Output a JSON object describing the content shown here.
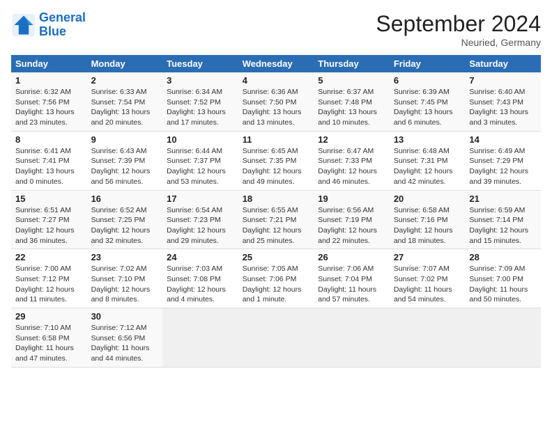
{
  "header": {
    "logo_line1": "General",
    "logo_line2": "Blue",
    "month": "September 2024",
    "location": "Neuried, Germany"
  },
  "columns": [
    "Sunday",
    "Monday",
    "Tuesday",
    "Wednesday",
    "Thursday",
    "Friday",
    "Saturday"
  ],
  "rows": [
    [
      {
        "day": "1",
        "sunrise": "Sunrise: 6:32 AM",
        "sunset": "Sunset: 7:56 PM",
        "daylight": "Daylight: 13 hours and 23 minutes."
      },
      {
        "day": "2",
        "sunrise": "Sunrise: 6:33 AM",
        "sunset": "Sunset: 7:54 PM",
        "daylight": "Daylight: 13 hours and 20 minutes."
      },
      {
        "day": "3",
        "sunrise": "Sunrise: 6:34 AM",
        "sunset": "Sunset: 7:52 PM",
        "daylight": "Daylight: 13 hours and 17 minutes."
      },
      {
        "day": "4",
        "sunrise": "Sunrise: 6:36 AM",
        "sunset": "Sunset: 7:50 PM",
        "daylight": "Daylight: 13 hours and 13 minutes."
      },
      {
        "day": "5",
        "sunrise": "Sunrise: 6:37 AM",
        "sunset": "Sunset: 7:48 PM",
        "daylight": "Daylight: 13 hours and 10 minutes."
      },
      {
        "day": "6",
        "sunrise": "Sunrise: 6:39 AM",
        "sunset": "Sunset: 7:45 PM",
        "daylight": "Daylight: 13 hours and 6 minutes."
      },
      {
        "day": "7",
        "sunrise": "Sunrise: 6:40 AM",
        "sunset": "Sunset: 7:43 PM",
        "daylight": "Daylight: 13 hours and 3 minutes."
      }
    ],
    [
      {
        "day": "8",
        "sunrise": "Sunrise: 6:41 AM",
        "sunset": "Sunset: 7:41 PM",
        "daylight": "Daylight: 13 hours and 0 minutes."
      },
      {
        "day": "9",
        "sunrise": "Sunrise: 6:43 AM",
        "sunset": "Sunset: 7:39 PM",
        "daylight": "Daylight: 12 hours and 56 minutes."
      },
      {
        "day": "10",
        "sunrise": "Sunrise: 6:44 AM",
        "sunset": "Sunset: 7:37 PM",
        "daylight": "Daylight: 12 hours and 53 minutes."
      },
      {
        "day": "11",
        "sunrise": "Sunrise: 6:45 AM",
        "sunset": "Sunset: 7:35 PM",
        "daylight": "Daylight: 12 hours and 49 minutes."
      },
      {
        "day": "12",
        "sunrise": "Sunrise: 6:47 AM",
        "sunset": "Sunset: 7:33 PM",
        "daylight": "Daylight: 12 hours and 46 minutes."
      },
      {
        "day": "13",
        "sunrise": "Sunrise: 6:48 AM",
        "sunset": "Sunset: 7:31 PM",
        "daylight": "Daylight: 12 hours and 42 minutes."
      },
      {
        "day": "14",
        "sunrise": "Sunrise: 6:49 AM",
        "sunset": "Sunset: 7:29 PM",
        "daylight": "Daylight: 12 hours and 39 minutes."
      }
    ],
    [
      {
        "day": "15",
        "sunrise": "Sunrise: 6:51 AM",
        "sunset": "Sunset: 7:27 PM",
        "daylight": "Daylight: 12 hours and 36 minutes."
      },
      {
        "day": "16",
        "sunrise": "Sunrise: 6:52 AM",
        "sunset": "Sunset: 7:25 PM",
        "daylight": "Daylight: 12 hours and 32 minutes."
      },
      {
        "day": "17",
        "sunrise": "Sunrise: 6:54 AM",
        "sunset": "Sunset: 7:23 PM",
        "daylight": "Daylight: 12 hours and 29 minutes."
      },
      {
        "day": "18",
        "sunrise": "Sunrise: 6:55 AM",
        "sunset": "Sunset: 7:21 PM",
        "daylight": "Daylight: 12 hours and 25 minutes."
      },
      {
        "day": "19",
        "sunrise": "Sunrise: 6:56 AM",
        "sunset": "Sunset: 7:19 PM",
        "daylight": "Daylight: 12 hours and 22 minutes."
      },
      {
        "day": "20",
        "sunrise": "Sunrise: 6:58 AM",
        "sunset": "Sunset: 7:16 PM",
        "daylight": "Daylight: 12 hours and 18 minutes."
      },
      {
        "day": "21",
        "sunrise": "Sunrise: 6:59 AM",
        "sunset": "Sunset: 7:14 PM",
        "daylight": "Daylight: 12 hours and 15 minutes."
      }
    ],
    [
      {
        "day": "22",
        "sunrise": "Sunrise: 7:00 AM",
        "sunset": "Sunset: 7:12 PM",
        "daylight": "Daylight: 12 hours and 11 minutes."
      },
      {
        "day": "23",
        "sunrise": "Sunrise: 7:02 AM",
        "sunset": "Sunset: 7:10 PM",
        "daylight": "Daylight: 12 hours and 8 minutes."
      },
      {
        "day": "24",
        "sunrise": "Sunrise: 7:03 AM",
        "sunset": "Sunset: 7:08 PM",
        "daylight": "Daylight: 12 hours and 4 minutes."
      },
      {
        "day": "25",
        "sunrise": "Sunrise: 7:05 AM",
        "sunset": "Sunset: 7:06 PM",
        "daylight": "Daylight: 12 hours and 1 minute."
      },
      {
        "day": "26",
        "sunrise": "Sunrise: 7:06 AM",
        "sunset": "Sunset: 7:04 PM",
        "daylight": "Daylight: 11 hours and 57 minutes."
      },
      {
        "day": "27",
        "sunrise": "Sunrise: 7:07 AM",
        "sunset": "Sunset: 7:02 PM",
        "daylight": "Daylight: 11 hours and 54 minutes."
      },
      {
        "day": "28",
        "sunrise": "Sunrise: 7:09 AM",
        "sunset": "Sunset: 7:00 PM",
        "daylight": "Daylight: 11 hours and 50 minutes."
      }
    ],
    [
      {
        "day": "29",
        "sunrise": "Sunrise: 7:10 AM",
        "sunset": "Sunset: 6:58 PM",
        "daylight": "Daylight: 11 hours and 47 minutes."
      },
      {
        "day": "30",
        "sunrise": "Sunrise: 7:12 AM",
        "sunset": "Sunset: 6:56 PM",
        "daylight": "Daylight: 11 hours and 44 minutes."
      },
      null,
      null,
      null,
      null,
      null
    ]
  ]
}
